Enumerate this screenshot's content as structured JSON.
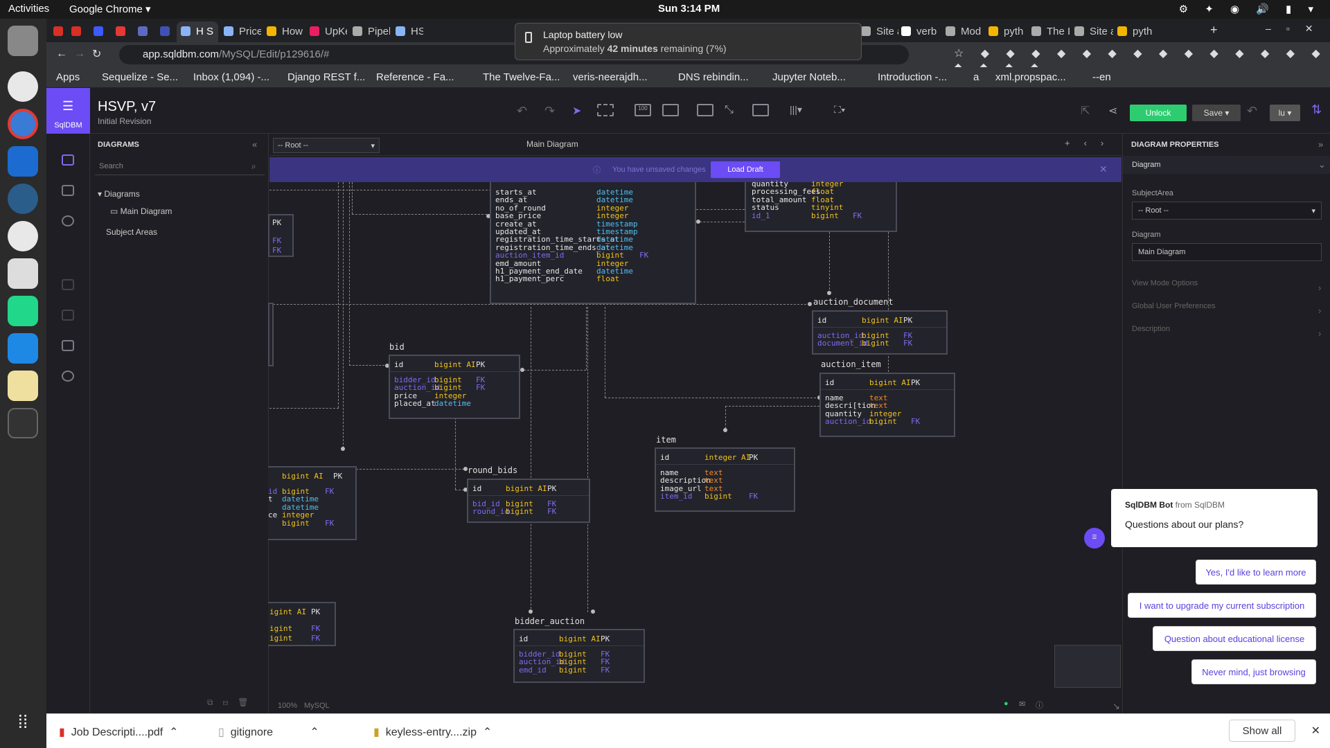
{
  "topbar": {
    "activities": "Activities",
    "app": "Google Chrome ▾",
    "clock": "Sun  3:14 PM"
  },
  "browser": {
    "tabs": [
      "M",
      "M",
      "◆",
      "g",
      "✕",
      "",
      "H S",
      "Price",
      "How",
      "UpKe",
      "Pipel",
      "HSV",
      "Site a",
      "verb",
      "Mod",
      "pyth",
      "The I",
      "Site a",
      "pyth"
    ],
    "url_host": "app.sqldbm.com",
    "url_path": "/MySQL/Edit/p129616/#",
    "bookmarks": [
      "Apps",
      "Sequelize - Se...",
      "Inbox (1,094) -...",
      "Django REST f...",
      "Reference - Fa...",
      "The Twelve-Fa...",
      "veris-neerajdh...",
      "DNS rebindin...",
      "Jupyter Noteb...",
      "Introduction -...",
      "a",
      "xml.propspac...",
      "--en"
    ]
  },
  "toast": {
    "title": "Laptop battery low",
    "prefix": "Approximately ",
    "minutes": "42 minutes",
    "suffix": " remaining (7%)"
  },
  "app": {
    "logo": "SqlDBM",
    "title": "HSVP, v7",
    "subtitle": "Initial Revision",
    "unlock": "Unlock",
    "save": "Save ▾",
    "user": "lu ▾"
  },
  "left": {
    "header": "DIAGRAMS",
    "search_placeholder": "Search",
    "tree_root": "Diagrams",
    "tree_item": "Main Diagram",
    "subject_areas": "Subject Areas"
  },
  "canvas": {
    "root_select": "-- Root --",
    "tab": "Main Diagram",
    "banner_msg": "You have unsaved changes",
    "load_draft": "Load Draft",
    "zoom": "100%",
    "db": "MySQL"
  },
  "tables": {
    "auction": {
      "rows": [
        [
          "starts_at",
          "datetime",
          ""
        ],
        [
          "ends_at",
          "datetime",
          ""
        ],
        [
          "no_of_round",
          "integer",
          ""
        ],
        [
          "base_price",
          "integer",
          ""
        ],
        [
          "create_at",
          "timestamp",
          ""
        ],
        [
          "updated_at",
          "timestamp",
          ""
        ],
        [
          "registration_time_starts_at",
          "datetime",
          ""
        ],
        [
          "registration_time_ends_at",
          "datetime",
          ""
        ],
        [
          "auction_item_id",
          "bigint",
          "FK"
        ],
        [
          "emd_amount",
          "integer",
          ""
        ],
        [
          "h1_payment_end_date",
          "datetime",
          ""
        ],
        [
          "h1_payment_perc",
          "float",
          ""
        ]
      ]
    },
    "payment": {
      "rows": [
        [
          "quantity",
          "integer",
          ""
        ],
        [
          "processing_fees",
          "float",
          ""
        ],
        [
          "total_amount",
          "float",
          ""
        ],
        [
          "status",
          "tinyint",
          ""
        ],
        [
          "id_1",
          "bigint",
          "FK"
        ]
      ]
    },
    "auction_document": {
      "name": "auction_document",
      "pk": [
        "id",
        "bigint AI",
        "PK"
      ],
      "rows": [
        [
          "auction_id",
          "bigint",
          "FK"
        ],
        [
          "document_id",
          "bigint",
          "FK"
        ]
      ]
    },
    "auction_item": {
      "name": "auction_item",
      "pk": [
        "id",
        "bigint AI",
        "PK"
      ],
      "rows": [
        [
          "name",
          "text",
          ""
        ],
        [
          "descri[tion",
          "text",
          ""
        ],
        [
          "quantity",
          "integer",
          ""
        ],
        [
          "auction_id",
          "bigint",
          "FK"
        ]
      ]
    },
    "bid": {
      "name": "bid",
      "pk": [
        "id",
        "bigint AI",
        "PK"
      ],
      "rows": [
        [
          "bidder_id",
          "bigint",
          "FK"
        ],
        [
          "auction_id",
          "bigint",
          "FK"
        ],
        [
          "price",
          "integer",
          ""
        ],
        [
          "placed_at",
          "datetime",
          ""
        ]
      ]
    },
    "round_bids": {
      "name": "round_bids",
      "pk": [
        "id",
        "bigint AI",
        "PK"
      ],
      "rows": [
        [
          "bid_id",
          "bigint",
          "FK"
        ],
        [
          "round_id",
          "bigint",
          "FK"
        ]
      ]
    },
    "item": {
      "name": "item",
      "pk": [
        "id",
        "integer AI",
        "PK"
      ],
      "rows": [
        [
          "name",
          "text",
          ""
        ],
        [
          "description",
          "text",
          ""
        ],
        [
          "image_url",
          "text",
          ""
        ],
        [
          "item_id",
          "bigint",
          "FK"
        ]
      ]
    },
    "bidder_auction": {
      "name": "bidder_auction",
      "pk": [
        "id",
        "bigint AI",
        "PK"
      ],
      "rows": [
        [
          "bidder_id",
          "bigint",
          "FK"
        ],
        [
          "auction_id",
          "bigint",
          "FK"
        ],
        [
          "emd_id",
          "bigint",
          "FK"
        ]
      ]
    },
    "partial1": {
      "rows": [
        [
          "PK",
          ""
        ],
        [
          "FK",
          ""
        ],
        [
          "FK",
          ""
        ]
      ]
    },
    "partial2": {
      "pk": [
        "bigint AI",
        "PK"
      ],
      "rows": [
        [
          "id",
          "bigint",
          "FK"
        ],
        [
          "t",
          "datetime",
          ""
        ],
        [
          "",
          "datetime",
          ""
        ],
        [
          "ce",
          "integer",
          ""
        ],
        [
          "",
          "bigint",
          "FK"
        ]
      ]
    },
    "partial3": {
      "pk": [
        "igint AI",
        "PK"
      ],
      "rows": [
        [
          "igint",
          "FK"
        ],
        [
          "igint",
          "FK"
        ]
      ]
    }
  },
  "right": {
    "header": "DIAGRAM PROPERTIES",
    "section": "Diagram",
    "subject_area_label": "SubjectArea",
    "subject_area_value": "-- Root --",
    "diagram_label": "Diagram",
    "diagram_value": "Main Diagram",
    "view_mode": "View Mode Options",
    "global_prefs": "Global User Preferences",
    "description": "Description"
  },
  "chat": {
    "from_name": "SqlDBM Bot",
    "from_suffix": " from SqlDBM",
    "question": "Questions about our plans?",
    "options": [
      "Yes, I'd like to learn more",
      "I want to upgrade my current subscription",
      "Question about educational license",
      "Never mind, just browsing"
    ]
  },
  "downloads": {
    "items": [
      "Job Descripti....pdf",
      "gitignore",
      "keyless-entry....zip"
    ],
    "show_all": "Show all"
  }
}
